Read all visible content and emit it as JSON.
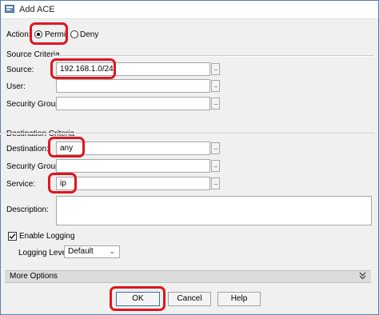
{
  "window": {
    "title": "Add ACE"
  },
  "action": {
    "label": "Action:",
    "permit_label": "Permit",
    "deny_label": "Deny",
    "selected": "Permit"
  },
  "source_criteria": {
    "title": "Source Criteria",
    "source": {
      "label": "Source:",
      "value": "192.168.1.0/24"
    },
    "user": {
      "label": "User:",
      "value": ""
    },
    "security_group": {
      "label": "Security Group:",
      "value": ""
    },
    "browse_label": "..."
  },
  "destination_criteria": {
    "title": "Destination Criteria",
    "destination": {
      "label": "Destination:",
      "value": "any"
    },
    "security_group": {
      "label": "Security Group:",
      "value": ""
    },
    "service": {
      "label": "Service:",
      "value": "ip"
    },
    "browse_label": "..."
  },
  "description": {
    "label": "Description:",
    "value": ""
  },
  "logging": {
    "enable_label": "Enable Logging",
    "enabled": true,
    "level_label": "Logging Level:",
    "level_value": "Default"
  },
  "more_options": {
    "label": "More Options"
  },
  "buttons": {
    "ok": "OK",
    "cancel": "Cancel",
    "help": "Help"
  },
  "colors": {
    "highlight": "#e0151f",
    "window_border": "#5a7fa8",
    "dialog_bg": "#f0f0f0"
  },
  "icons": [
    "app-icon",
    "chevron-down-icon",
    "double-chevron-down-icon",
    "checkmark-icon"
  ]
}
